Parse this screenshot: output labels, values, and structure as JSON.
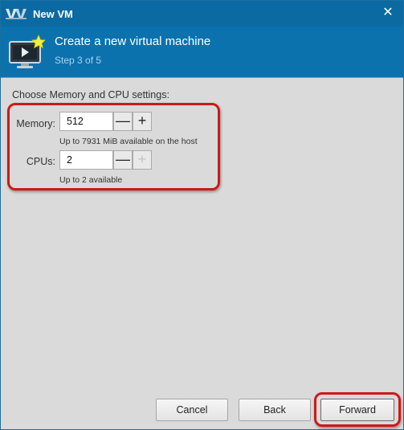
{
  "window": {
    "title": "New VM",
    "close_glyph": "✕"
  },
  "banner": {
    "title": "Create a new virtual machine",
    "step": "Step 3 of 5",
    "icon": "monitor-with-star-icon"
  },
  "settings": {
    "heading": "Choose Memory and CPU settings:",
    "memory": {
      "label": "Memory:",
      "value": "512",
      "hint": "Up to 7931 MiB available on the host",
      "decrement_glyph": "—",
      "increment_glyph": "+"
    },
    "cpus": {
      "label": "CPUs:",
      "value": "2",
      "hint": "Up to 2 available",
      "decrement_glyph": "—",
      "increment_glyph": "+"
    }
  },
  "buttons": {
    "cancel": "Cancel",
    "back": "Back",
    "forward": "Forward"
  },
  "colors": {
    "titlebar": "#0b6aa2",
    "banner": "#0c72ae",
    "highlight": "#d01818",
    "background": "#dadada"
  }
}
